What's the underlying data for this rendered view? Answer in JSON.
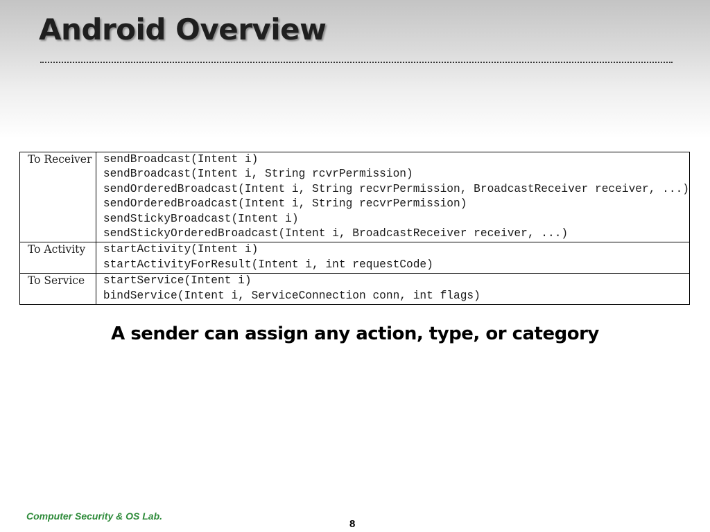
{
  "slide": {
    "title": "Android Overview",
    "caption": "A sender can assign any action, type, or category",
    "footer": "Computer Security & OS Lab.",
    "page_number": "8"
  },
  "table": {
    "rows": [
      {
        "target": "To Receiver",
        "methods": [
          "sendBroadcast(Intent i)",
          "sendBroadcast(Intent i, String rcvrPermission)",
          "sendOrderedBroadcast(Intent i, String recvrPermission, BroadcastReceiver receiver, ...)",
          "sendOrderedBroadcast(Intent i, String recvrPermission)",
          "sendStickyBroadcast(Intent i)",
          "sendStickyOrderedBroadcast(Intent i, BroadcastReceiver receiver, ...)"
        ]
      },
      {
        "target": "To Activity",
        "methods": [
          "startActivity(Intent i)",
          "startActivityForResult(Intent i, int requestCode)"
        ]
      },
      {
        "target": "To Service",
        "methods": [
          "startService(Intent i)",
          "bindService(Intent i, ServiceConnection conn, int flags)"
        ]
      }
    ]
  },
  "colors": {
    "footer_text": "#2e8b3a",
    "title_text": "#1f1f1f"
  }
}
